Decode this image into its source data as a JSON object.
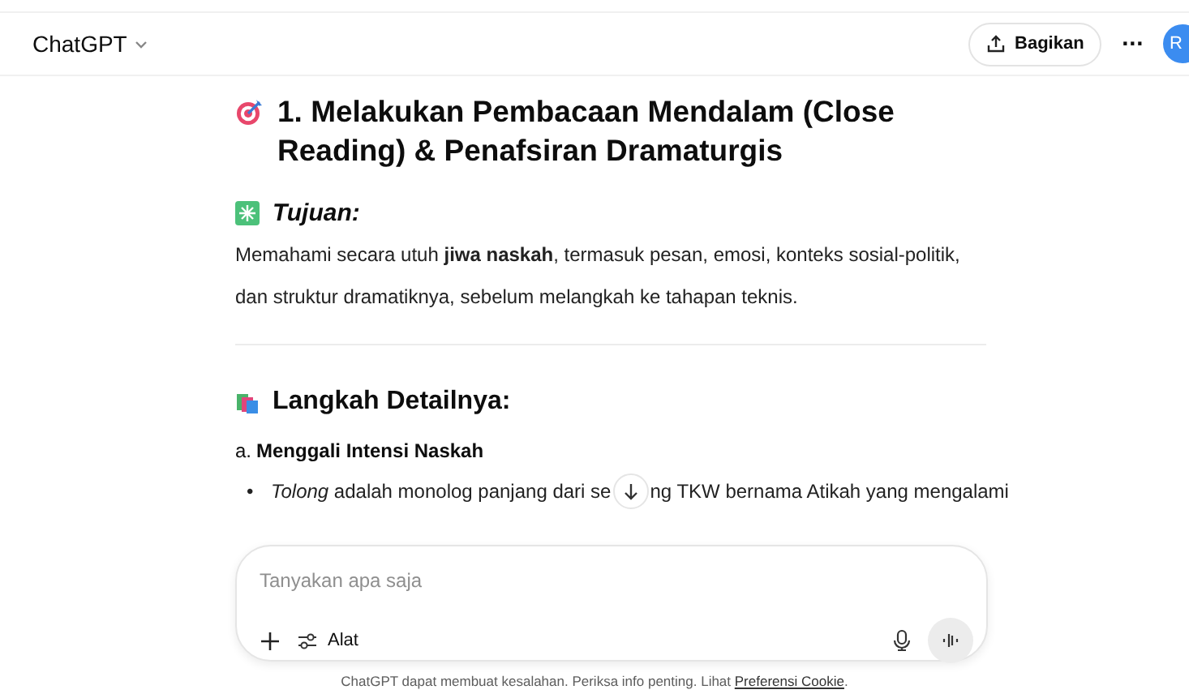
{
  "header": {
    "title": "ChatGPT",
    "share_button": "Bagikan",
    "more_button": "···",
    "avatar": "R"
  },
  "message": {
    "heading": "1. Melakukan Pembacaan Mendalam (Close Reading) & Penafsiran Dramaturgis",
    "goal_heading": "Tujuan:",
    "goal_text": "Memahami secara utuh **jiwa naskah**, termasuk pesan, emosi, konteks sosial-politik, dan struktur dramatiknya, sebelum melangkah ke tahapan teknis.",
    "steps_heading": "Langkah Detailnya:",
    "step_label": "a.",
    "step_title": "Menggali Intensi Naskah",
    "bullet": {
      "marker": "•",
      "line_start": "*Tolong* adalah monolog panjang dari se",
      "line_end": "ng TKW bernama Atikah yang mengalami"
    }
  },
  "composer": {
    "placeholder": "Tanyakan apa saja",
    "tools_button": "Alat"
  },
  "footer": {
    "text": "ChatGPT dapat membuat kesalahan. Periksa info penting. Lihat ",
    "link": "Preferensi Cookie",
    "end": "."
  }
}
